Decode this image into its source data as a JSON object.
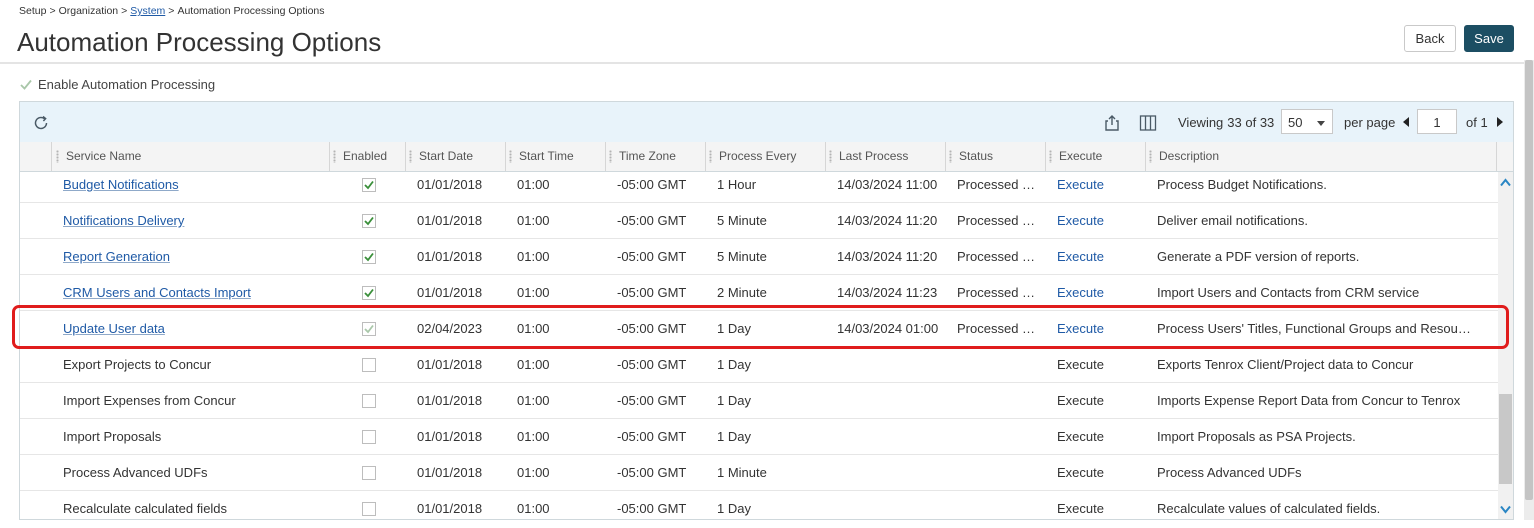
{
  "breadcrumb": {
    "items": [
      "Setup",
      "Organization",
      "System",
      "Automation Processing Options"
    ],
    "separator": ">"
  },
  "page": {
    "title": "Automation Processing Options"
  },
  "actions": {
    "back_label": "Back",
    "save_label": "Save"
  },
  "enable_automation": {
    "label": "Enable Automation Processing",
    "checked": true
  },
  "toolbar": {
    "viewing_label": "Viewing",
    "viewing_count": "33 of 33",
    "per_page_value": "50",
    "per_page_label": "per page",
    "page_value": "1",
    "of_label": "of 1"
  },
  "columns": [
    "Service Name",
    "Enabled",
    "Start Date",
    "Start Time",
    "Time Zone",
    "Process Every",
    "Last Process",
    "Status",
    "Execute",
    "Description"
  ],
  "rows": [
    {
      "name": "Budget Notifications",
      "enabled": true,
      "start_date": "01/01/2018",
      "start_time": "01:00",
      "time_zone": "-05:00 GMT",
      "process_every": "1 Hour",
      "last_process": "14/03/2024 11:00",
      "status": "Processed s...",
      "execute": "Execute",
      "description": "Process Budget Notifications."
    },
    {
      "name": "Notifications Delivery",
      "enabled": true,
      "start_date": "01/01/2018",
      "start_time": "01:00",
      "time_zone": "-05:00 GMT",
      "process_every": "5 Minute",
      "last_process": "14/03/2024 11:20",
      "status": "Processed s...",
      "execute": "Execute",
      "description": "Deliver email notifications."
    },
    {
      "name": "Report Generation",
      "enabled": true,
      "start_date": "01/01/2018",
      "start_time": "01:00",
      "time_zone": "-05:00 GMT",
      "process_every": "5 Minute",
      "last_process": "14/03/2024 11:20",
      "status": "Processed s...",
      "execute": "Execute",
      "description": "Generate a PDF version of reports."
    },
    {
      "name": "CRM Users and Contacts Import",
      "enabled": true,
      "start_date": "01/01/2018",
      "start_time": "01:00",
      "time_zone": "-05:00 GMT",
      "process_every": "2 Minute",
      "last_process": "14/03/2024 11:23",
      "status": "Processed s...",
      "execute": "Execute",
      "description": "Import Users and Contacts from CRM service"
    },
    {
      "name": "Update User data",
      "enabled": true,
      "start_date": "02/04/2023",
      "start_time": "01:00",
      "time_zone": "-05:00 GMT",
      "process_every": "1 Day",
      "last_process": "14/03/2024 01:00",
      "status": "Processed s...",
      "execute": "Execute",
      "description": "Process Users' Titles, Functional Groups and Resource ...",
      "highlighted": true
    },
    {
      "name": "Export Projects to Concur",
      "enabled": false,
      "start_date": "01/01/2018",
      "start_time": "01:00",
      "time_zone": "-05:00 GMT",
      "process_every": "1 Day",
      "last_process": "",
      "status": "",
      "execute": "Execute",
      "description": "Exports Tenrox Client/Project data to Concur"
    },
    {
      "name": "Import Expenses from Concur",
      "enabled": false,
      "start_date": "01/01/2018",
      "start_time": "01:00",
      "time_zone": "-05:00 GMT",
      "process_every": "1 Day",
      "last_process": "",
      "status": "",
      "execute": "Execute",
      "description": "Imports Expense Report Data from Concur to Tenrox"
    },
    {
      "name": "Import Proposals",
      "enabled": false,
      "start_date": "01/01/2018",
      "start_time": "01:00",
      "time_zone": "-05:00 GMT",
      "process_every": "1 Day",
      "last_process": "",
      "status": "",
      "execute": "Execute",
      "description": "Import Proposals as PSA Projects."
    },
    {
      "name": "Process Advanced UDFs",
      "enabled": false,
      "start_date": "01/01/2018",
      "start_time": "01:00",
      "time_zone": "-05:00 GMT",
      "process_every": "1 Minute",
      "last_process": "",
      "status": "",
      "execute": "Execute",
      "description": "Process Advanced UDFs"
    },
    {
      "name": "Recalculate calculated fields",
      "enabled": false,
      "start_date": "01/01/2018",
      "start_time": "01:00",
      "time_zone": "-05:00 GMT",
      "process_every": "1 Day",
      "last_process": "",
      "status": "",
      "execute": "Execute",
      "description": "Recalculate values of calculated fields."
    }
  ],
  "colors": {
    "link": "#1f5aa6",
    "save_button": "#1c4e63",
    "toolbar_bg": "#e8f3fa",
    "highlight_border": "#e01c1c",
    "check_green": "#3a8f3a"
  },
  "icons": [
    "refresh-icon",
    "export-icon",
    "columns-icon",
    "chevron-left-icon",
    "chevron-right-icon",
    "chevron-up-icon",
    "chevron-down-icon",
    "check-icon"
  ]
}
